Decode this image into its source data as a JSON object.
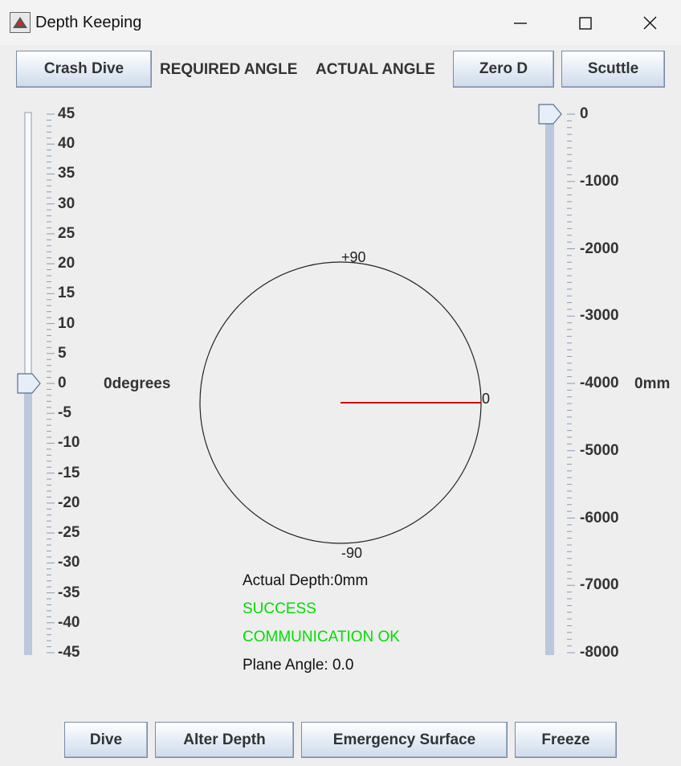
{
  "window": {
    "title": "Depth Keeping",
    "minimize_glyph": "—",
    "close_glyph": "✕"
  },
  "top_bar": {
    "crash_dive": "Crash Dive",
    "required_angle": "REQUIRED ANGLE",
    "actual_angle": "ACTUAL ANGLE",
    "zero_d": "Zero D",
    "scuttle": "Scuttle"
  },
  "angle_slider": {
    "value": 0,
    "min": -45,
    "max": 45,
    "labels": [
      "45",
      "40",
      "35",
      "30",
      "25",
      "20",
      "15",
      "10",
      "5",
      "0",
      "-5",
      "-10",
      "-15",
      "-20",
      "-25",
      "-30",
      "-35",
      "-40",
      "-45"
    ],
    "readout": "0degrees"
  },
  "depth_slider": {
    "value": 0,
    "min": -8000,
    "max": 0,
    "labels": [
      "0",
      "-1000",
      "-2000",
      "-3000",
      "-4000",
      "-5000",
      "-6000",
      "-7000",
      "-8000"
    ],
    "readout": "0mm"
  },
  "dial": {
    "top_label": "+90",
    "right_label": "0",
    "bottom_label": "-90",
    "angle": 0,
    "needle_color": "#cc0000"
  },
  "status": {
    "actual_depth": "Actual Depth:0mm",
    "result": "SUCCESS",
    "communication": "COMMUNICATION OK",
    "plane_angle": "Plane Angle: 0.0",
    "ok_color": "#00dd00"
  },
  "bottom_bar": {
    "dive": "Dive",
    "alter_depth": "Alter Depth",
    "emergency_surface": "Emergency Surface",
    "freeze": "Freeze"
  }
}
